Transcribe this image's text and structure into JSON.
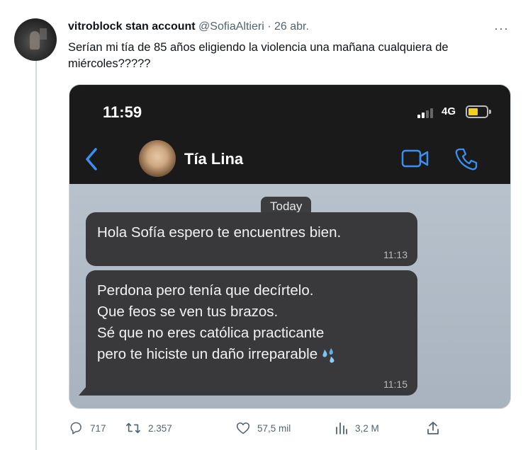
{
  "tweet": {
    "display_name": "vitroblock stan account",
    "handle": "@SofiaAltieri",
    "separator": "·",
    "date": "26 abr.",
    "more": "···",
    "text": "Serían mi tía de 85 años eligiendo la violencia una mañana cualquiera de miércoles?????"
  },
  "screenshot": {
    "status_time": "11:59",
    "network": "4G",
    "battery_color": "#f4cf1d",
    "contact_name": "Tía Lina",
    "date_chip": "Today",
    "messages": [
      {
        "text": "Hola Sofía espero te encuentres bien.",
        "time": "11:13"
      },
      {
        "text": "Perdona pero tenía que decírtelo.\nQue feos se ven tus brazos.\nSé que no eres católica practicante\npero te hiciste un daño irreparable",
        "time": "11:15",
        "emoji": "sweat-droplets-icon"
      }
    ],
    "accent_color": "#3b8ff0"
  },
  "actions": {
    "replies": "717",
    "retweets": "2.357",
    "likes": "57,5 mil",
    "views": "3,2 M"
  }
}
